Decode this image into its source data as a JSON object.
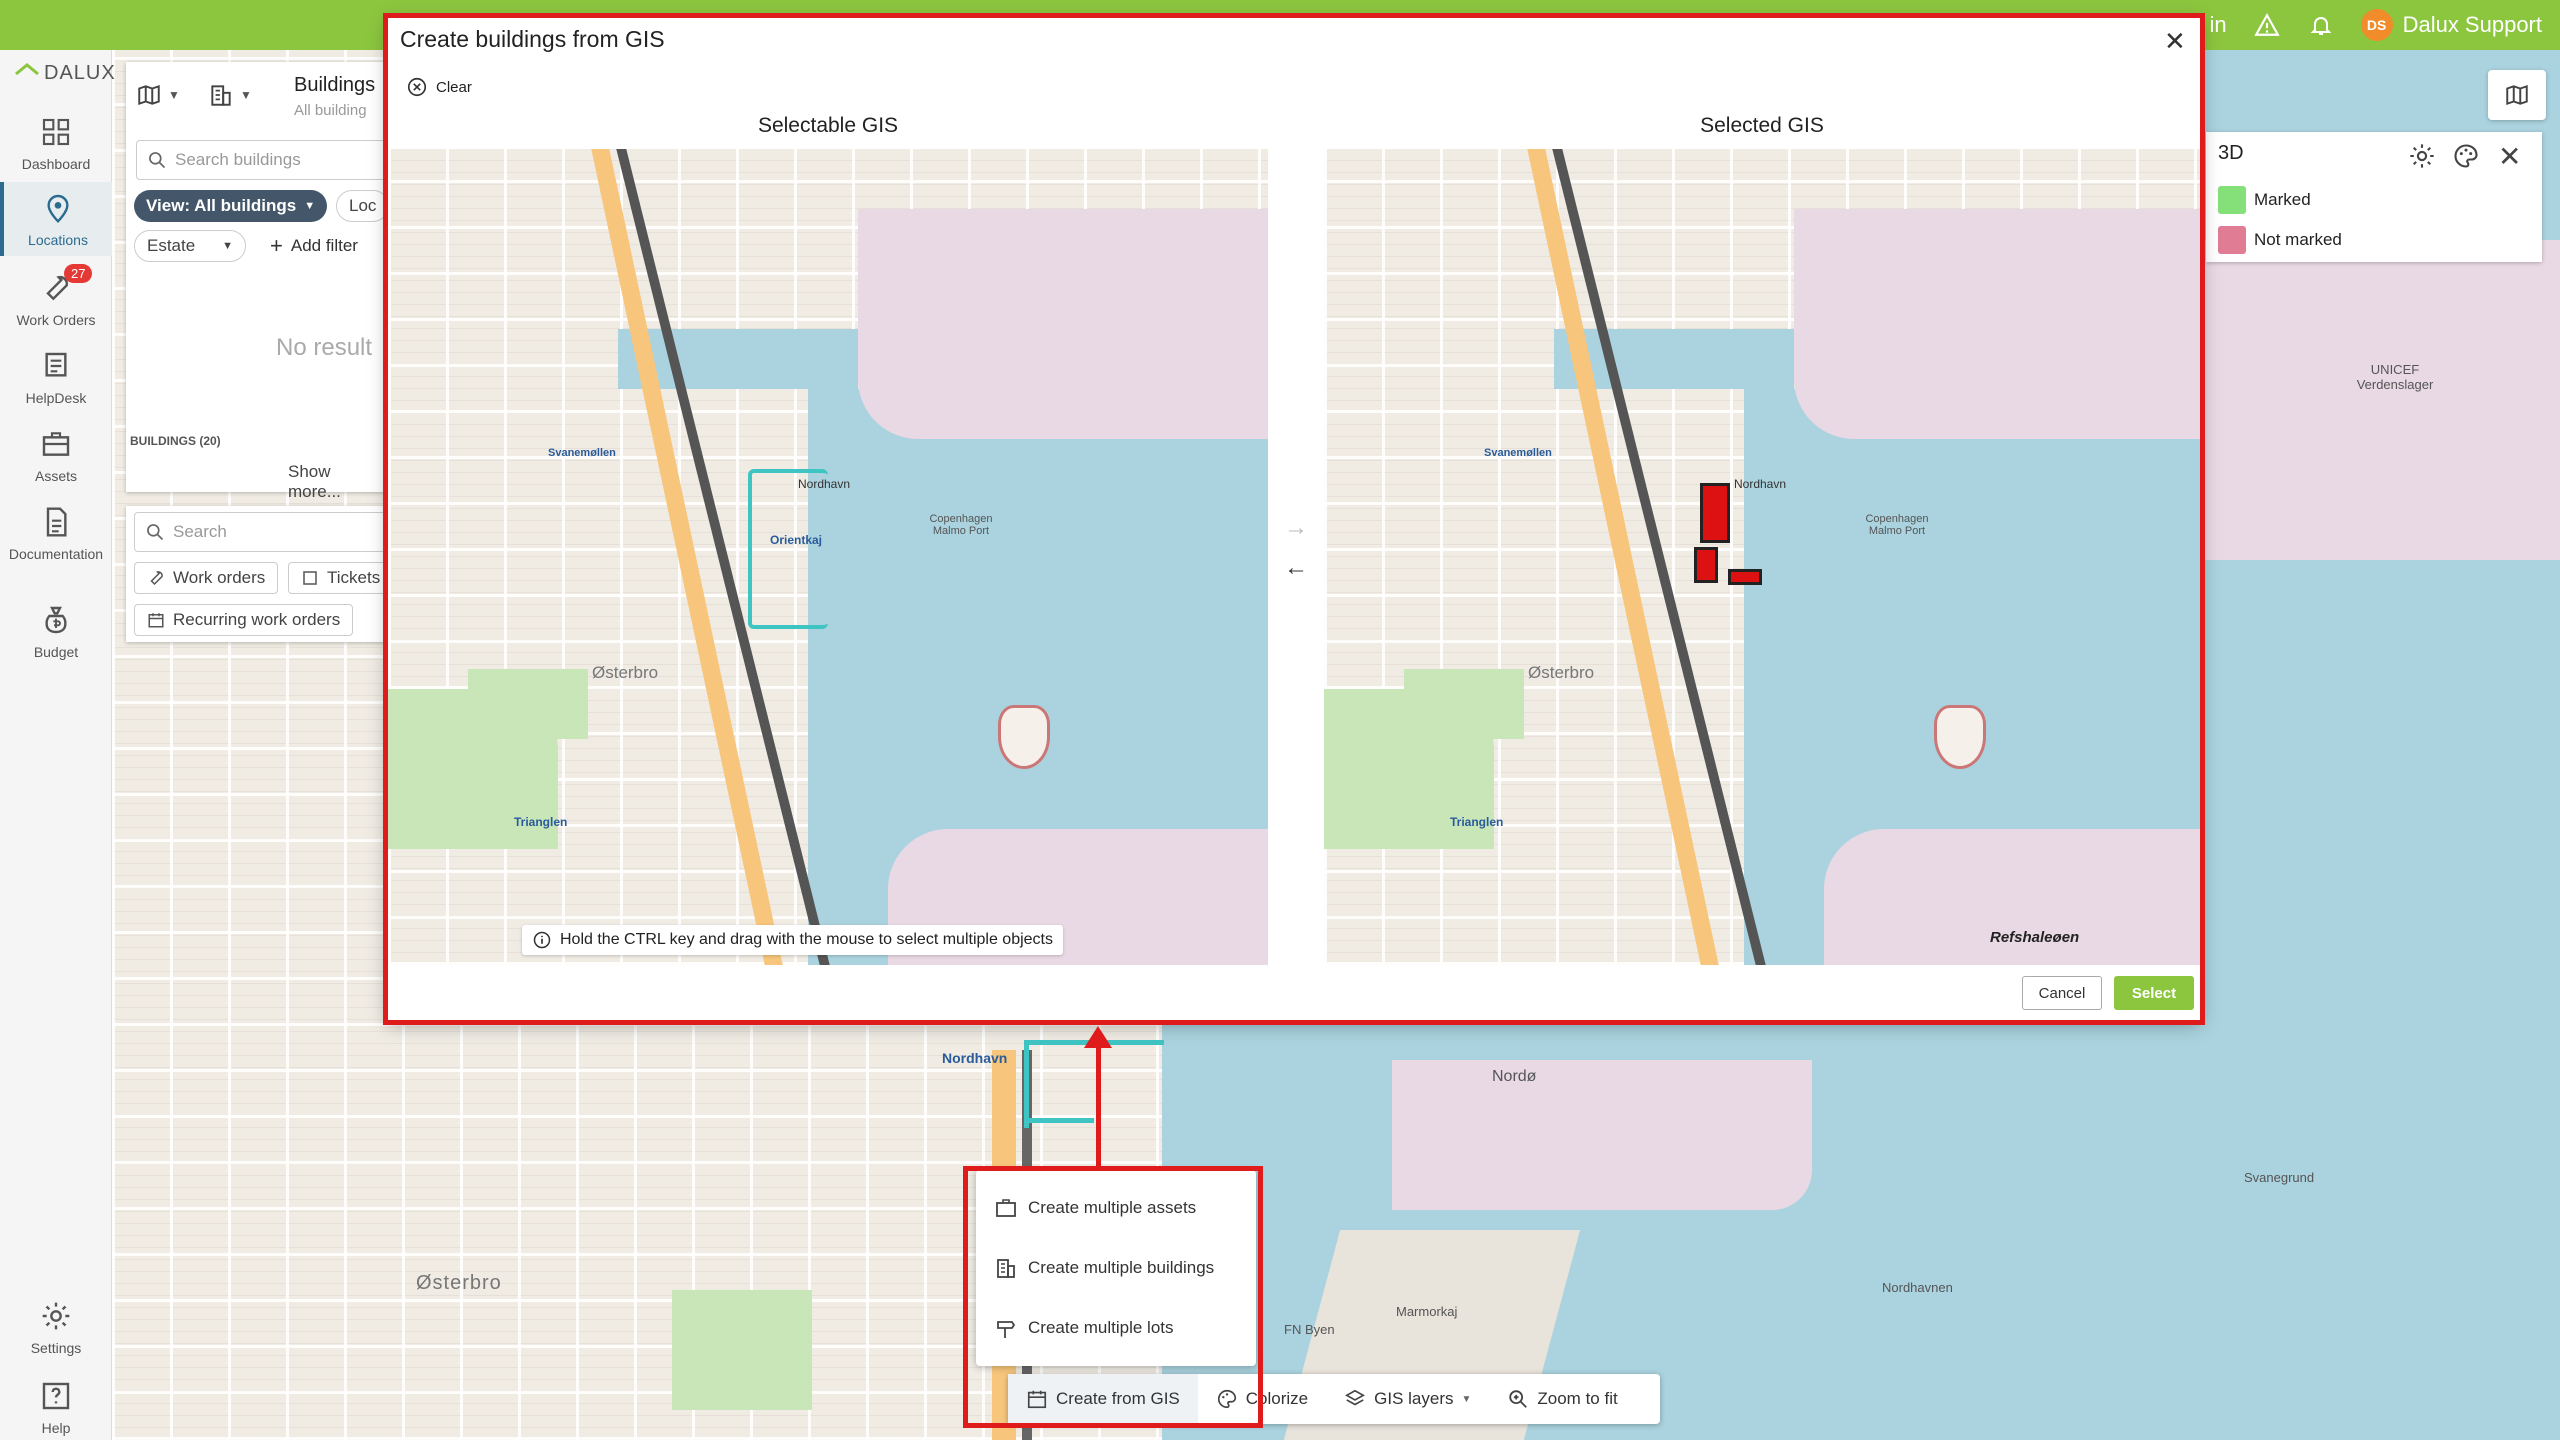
{
  "topbar": {
    "partial_text": "in",
    "user_initials": "DS",
    "user_name": "Dalux Support",
    "color": "#8cc63f"
  },
  "logo": {
    "text": "DALUX"
  },
  "nav": {
    "items": [
      {
        "label": "Dashboard",
        "icon": "dashboard-icon"
      },
      {
        "label": "Locations",
        "icon": "location-pin-icon",
        "active": true
      },
      {
        "label": "Work Orders",
        "icon": "wrench-icon",
        "badge": "27"
      },
      {
        "label": "HelpDesk",
        "icon": "helpdesk-icon"
      },
      {
        "label": "Assets",
        "icon": "briefcase-icon"
      },
      {
        "label": "Documentation",
        "icon": "document-icon"
      },
      {
        "label": "Budget",
        "icon": "money-bag-icon"
      },
      {
        "label": "Settings",
        "icon": "gear-icon"
      },
      {
        "label": "Help",
        "icon": "help-icon"
      }
    ]
  },
  "buildings_panel": {
    "title": "Buildings",
    "subtitle": "All building",
    "search_placeholder": "Search buildings",
    "view_label": "View: All buildings",
    "loc_tab": "Loc",
    "estate_filter": "Estate",
    "add_filter": "Add filter",
    "no_results": "No result",
    "buildings_count": "BUILDINGS (20)",
    "show_more": "Show more..."
  },
  "search_panel": {
    "placeholder": "Search",
    "work_orders": "Work orders",
    "tickets": "Tickets",
    "recurring": "Recurring work orders"
  },
  "legend": {
    "title": "3D",
    "marked": "Marked",
    "not_marked": "Not marked",
    "marked_color": "#86e07a",
    "not_marked_color": "#e07d95"
  },
  "dialog": {
    "title": "Create buildings from GIS",
    "clear_label": "Clear",
    "selectable_label": "Selectable GIS",
    "selected_label": "Selected GIS",
    "hint": "Hold the CTRL key and drag with the mouse to select multiple objects",
    "cancel": "Cancel",
    "select": "Select",
    "select_color": "#8cc63f"
  },
  "map_labels": {
    "nordhavn": "Nordhavn",
    "orientkaj": "Orientkaj",
    "osterbro": "Østerbro",
    "copenhagen_port": "Copenhagen Malmo Port",
    "trianglen": "Trianglen",
    "svanemollen": "Svanemøllen",
    "refshaleoen": "Refshaleøen",
    "unicef": "UNICEF Verdenslager",
    "nordo": "Nordø",
    "fn_byen": "FN Byen",
    "marmorkaj": "Marmorkaj",
    "svanegrund": "Svanegrund",
    "nordhavnen": "Nordhavnen"
  },
  "popup": {
    "items": [
      "Create multiple assets",
      "Create multiple buildings",
      "Create multiple lots"
    ]
  },
  "toolbar": {
    "create_gis": "Create from GIS",
    "colorize": "Colorize",
    "gis_layers": "GIS layers",
    "zoom_fit": "Zoom to fit"
  }
}
